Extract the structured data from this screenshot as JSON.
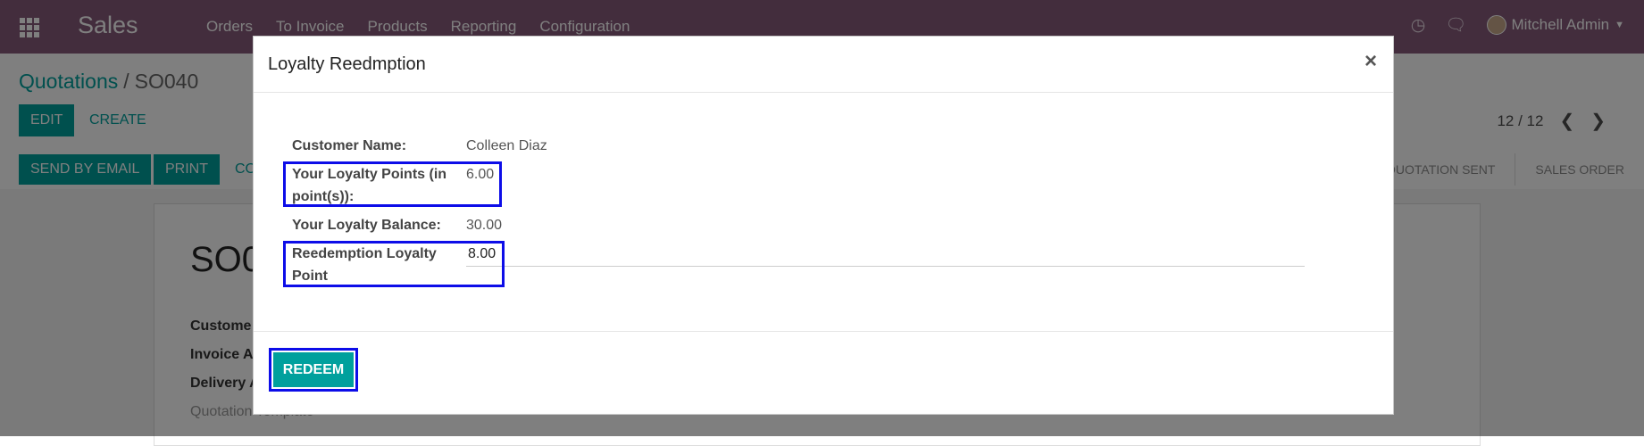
{
  "navbar": {
    "brand": "Sales",
    "menu": [
      "Orders",
      "To Invoice",
      "Products",
      "Reporting",
      "Configuration"
    ],
    "user": "Mitchell Admin",
    "icons": [
      "apps-icon",
      "clock-icon",
      "chat-icon"
    ]
  },
  "control_panel": {
    "breadcrumb_parent": "Quotations",
    "breadcrumb_sep": "/",
    "breadcrumb_current": "SO040",
    "edit_label": "EDIT",
    "create_label": "CREATE",
    "pager": "12 / 12",
    "send_email_label": "SEND BY EMAIL",
    "print_label": "PRINT",
    "confirm_label": "CO",
    "status": [
      "QUOTATION SENT",
      "SALES ORDER"
    ]
  },
  "sheet": {
    "name": "SO0",
    "fields": [
      "Custome",
      "Invoice A",
      "Delivery A",
      "Quotation Template"
    ]
  },
  "modal": {
    "title": "Loyalty Reedmption",
    "close": "×",
    "customer_label": "Customer Name:",
    "customer_value": "Colleen Diaz",
    "points_label": "Your Loyalty Points (in point(s)):",
    "points_value": "6.00",
    "balance_label": "Your Loyalty Balance:",
    "balance_value": "30.00",
    "redeem_label": "Reedemption Loyalty Point",
    "redeem_value": "8.00",
    "redeem_button": "REDEEM"
  },
  "colors": {
    "navbar": "#875a7b",
    "accent": "#00a09d",
    "highlight": "#0d0de8"
  }
}
